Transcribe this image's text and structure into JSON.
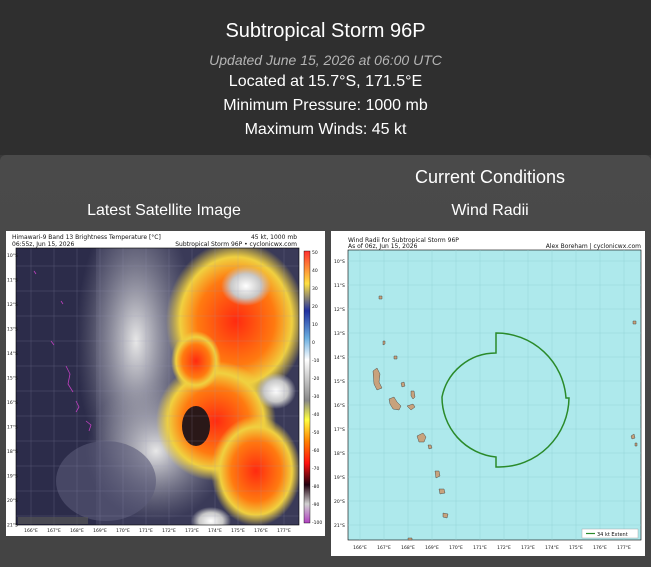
{
  "header": {
    "title": "Subtropical Storm 96P",
    "updated": "Updated June 15, 2026 at 06:00 UTC",
    "location": "Located at 15.7°S, 171.5°E",
    "pressure": "Minimum Pressure: 1000 mb",
    "winds": "Maximum Winds: 45 kt"
  },
  "current_conditions": {
    "title": "Current Conditions"
  },
  "satellite": {
    "heading": "Latest Satellite Image",
    "fig_title": "Himawari-9 Band 13 Brightness Temperature [°C]",
    "fig_time": "06:55z, Jun 15, 2026",
    "fig_right1": "45 kt, 1000 mb",
    "fig_right2": "Subtropical Storm 96P • cyclonicwx.com",
    "lat_labels": [
      "10°S",
      "11°S",
      "12°S",
      "13°S",
      "14°S",
      "15°S",
      "16°S",
      "17°S",
      "18°S",
      "19°S",
      "20°S",
      "21°S"
    ],
    "lon_labels": [
      "166°E",
      "167°E",
      "168°E",
      "169°E",
      "170°E",
      "171°E",
      "172°E",
      "173°E",
      "174°E",
      "175°E",
      "176°E",
      "177°E"
    ],
    "colorbar_labels": [
      "50",
      "40",
      "30",
      "20",
      "10",
      "0",
      "-10",
      "-20",
      "-30",
      "-40",
      "-50",
      "-60",
      "-70",
      "-80",
      "-90",
      "-100"
    ]
  },
  "wind_radii": {
    "heading": "Wind Radii",
    "fig_title": "Wind Radii for Subtropical Storm 96P",
    "fig_time": "As of 06z, Jun 15, 2026",
    "fig_credit": "Alex Boreham | cyclonicwx.com",
    "legend": "34 kt Extent",
    "lat_labels": [
      "10°S",
      "11°S",
      "12°S",
      "13°S",
      "14°S",
      "15°S",
      "16°S",
      "17°S",
      "18°S",
      "19°S",
      "20°S",
      "21°S"
    ],
    "lon_labels": [
      "166°E",
      "167°E",
      "168°E",
      "169°E",
      "170°E",
      "171°E",
      "172°E",
      "173°E",
      "174°E",
      "175°E",
      "176°E",
      "177°E"
    ]
  },
  "colors": {
    "ocean": "#aee9ec",
    "land": "#c8a27c",
    "radii": "#2a8a2a"
  }
}
